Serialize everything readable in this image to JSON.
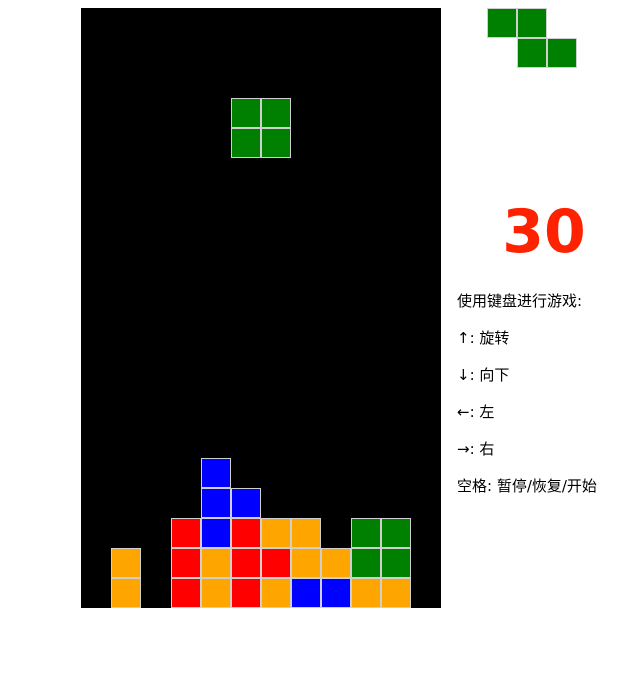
{
  "colors": {
    "green": "#008000",
    "blue": "#0000ff",
    "red": "#ff0000",
    "orange": "#ffa500",
    "score": "#ff2200",
    "board_bg": "#000000"
  },
  "board": {
    "cols": 12,
    "rows": 20,
    "falling_piece": {
      "color": "green",
      "cells": [
        [
          5,
          3
        ],
        [
          6,
          3
        ],
        [
          5,
          4
        ],
        [
          6,
          4
        ]
      ]
    },
    "settled_cells": [
      {
        "col": 4,
        "row": 15,
        "color": "blue"
      },
      {
        "col": 4,
        "row": 16,
        "color": "blue"
      },
      {
        "col": 5,
        "row": 16,
        "color": "blue"
      },
      {
        "col": 3,
        "row": 17,
        "color": "red"
      },
      {
        "col": 4,
        "row": 17,
        "color": "blue"
      },
      {
        "col": 5,
        "row": 17,
        "color": "red"
      },
      {
        "col": 6,
        "row": 17,
        "color": "orange"
      },
      {
        "col": 7,
        "row": 17,
        "color": "orange"
      },
      {
        "col": 9,
        "row": 17,
        "color": "green"
      },
      {
        "col": 10,
        "row": 17,
        "color": "green"
      },
      {
        "col": 1,
        "row": 18,
        "color": "orange"
      },
      {
        "col": 3,
        "row": 18,
        "color": "red"
      },
      {
        "col": 4,
        "row": 18,
        "color": "orange"
      },
      {
        "col": 5,
        "row": 18,
        "color": "red"
      },
      {
        "col": 6,
        "row": 18,
        "color": "red"
      },
      {
        "col": 7,
        "row": 18,
        "color": "orange"
      },
      {
        "col": 8,
        "row": 18,
        "color": "orange"
      },
      {
        "col": 9,
        "row": 18,
        "color": "green"
      },
      {
        "col": 10,
        "row": 18,
        "color": "green"
      },
      {
        "col": 1,
        "row": 19,
        "color": "orange"
      },
      {
        "col": 3,
        "row": 19,
        "color": "red"
      },
      {
        "col": 4,
        "row": 19,
        "color": "orange"
      },
      {
        "col": 5,
        "row": 19,
        "color": "red"
      },
      {
        "col": 6,
        "row": 19,
        "color": "orange"
      },
      {
        "col": 7,
        "row": 19,
        "color": "blue"
      },
      {
        "col": 8,
        "row": 19,
        "color": "blue"
      },
      {
        "col": 9,
        "row": 19,
        "color": "orange"
      },
      {
        "col": 10,
        "row": 19,
        "color": "orange"
      }
    ]
  },
  "next_piece": {
    "color": "green",
    "cells": [
      [
        0,
        0
      ],
      [
        1,
        0
      ],
      [
        1,
        1
      ],
      [
        2,
        1
      ]
    ]
  },
  "score": "30",
  "instructions": [
    "使用键盘进行游戏:",
    "↑: 旋转",
    "↓: 向下",
    "←: 左",
    "→: 右",
    "空格: 暂停/恢复/开始"
  ]
}
